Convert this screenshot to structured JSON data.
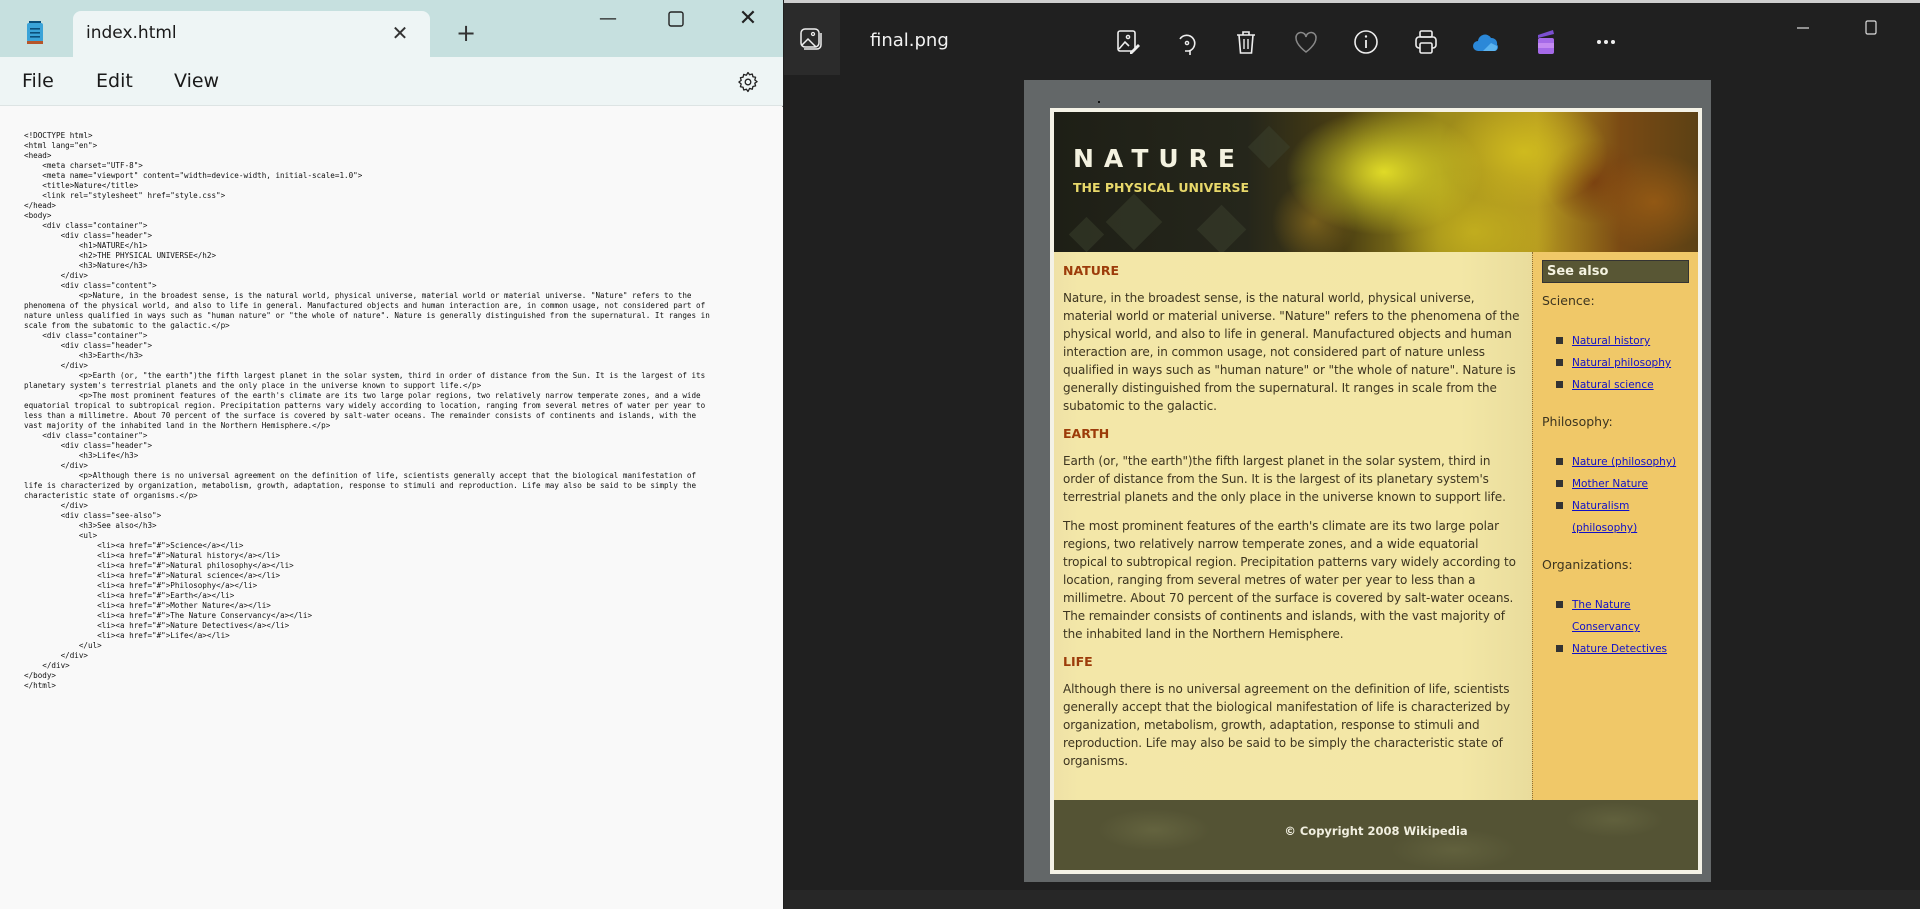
{
  "notepad": {
    "tab_title": "index.html",
    "menu": {
      "file": "File",
      "edit": "Edit",
      "view": "View"
    },
    "code_lines": [
      "<!DOCTYPE html>",
      "<html lang=\"en\">",
      "<head>",
      "    <meta charset=\"UTF-8\">",
      "    <meta name=\"viewport\" content=\"width=device-width, initial-scale=1.0\">",
      "    <title>Nature</title>",
      "    <link rel=\"stylesheet\" href=\"style.css\">",
      "</head>",
      "<body>",
      "    <div class=\"container\">",
      "        <div class=\"header\">",
      "            <h1>NATURE</h1>",
      "            <h2>THE PHYSICAL UNIVERSE</h2>",
      "            <h3>Nature</h3>",
      "        </div>",
      "        <div class=\"content\">",
      "            <p>Nature, in the broadest sense, is the natural world, physical universe, material world or material universe. \"Nature\" refers to the",
      "phenomena of the physical world, and also to life in general. Manufactured objects and human interaction are, in common usage, not considered part of",
      "nature unless qualified in ways such as \"human nature\" or \"the whole of nature\". Nature is generally distinguished from the supernatural. It ranges in",
      "scale from the subatomic to the galactic.</p>",
      "    <div class=\"container\">",
      "        <div class=\"header\">",
      "            <h3>Earth</h3>",
      "        </div>",
      "            <p>Earth (or, \"the earth\")the fifth largest planet in the solar system, third in order of distance from the Sun. It is the largest of its",
      "planetary system's terrestrial planets and the only place in the universe known to support life.</p>",
      "            <p>The most prominent features of the earth's climate are its two large polar regions, two relatively narrow temperate zones, and a wide",
      "equatorial tropical to subtropical region. Precipitation patterns vary widely according to location, ranging from several metres of water per year to",
      "less than a millimetre. About 70 percent of the surface is covered by salt-water oceans. The remainder consists of continents and islands, with the",
      "vast majority of the inhabited land in the Northern Hemisphere.</p>",
      "    <div class=\"container\">",
      "        <div class=\"header\">",
      "            <h3>Life</h3>",
      "        </div>",
      "            <p>Although there is no universal agreement on the definition of life, scientists generally accept that the biological manifestation of",
      "life is characterized by organization, metabolism, growth, adaptation, response to stimuli and reproduction. Life may also be said to be simply the",
      "characteristic state of organisms.</p>",
      "        </div>",
      "        <div class=\"see-also\">",
      "            <h3>See also</h3>",
      "            <ul>",
      "                <li><a href=\"#\">Science</a></li>",
      "                <li><a href=\"#\">Natural history</a></li>",
      "                <li><a href=\"#\">Natural philosophy</a></li>",
      "                <li><a href=\"#\">Natural science</a></li>",
      "                <li><a href=\"#\">Philosophy</a></li>",
      "                <li><a href=\"#\">Earth</a></li>",
      "                <li><a href=\"#\">Mother Nature</a></li>",
      "                <li><a href=\"#\">The Nature Conservancy</a></li>",
      "                <li><a href=\"#\">Nature Detectives</a></li>",
      "                <li><a href=\"#\">Life</a></li>",
      "            </ul>",
      "        </div>",
      "    </div>",
      "</body>",
      "</html>"
    ]
  },
  "viewer": {
    "filename": "final.png",
    "toolbar": [
      {
        "name": "edit-image-icon"
      },
      {
        "name": "rotate-icon"
      },
      {
        "name": "delete-icon"
      },
      {
        "name": "favorite-icon"
      },
      {
        "name": "info-icon"
      },
      {
        "name": "print-icon"
      },
      {
        "name": "onedrive-icon"
      },
      {
        "name": "clipchamp-icon"
      },
      {
        "name": "more-icon"
      }
    ],
    "colors": {
      "onedrive": "#2b88d8",
      "clipchamp": "#9b5de5"
    }
  },
  "site": {
    "title": "NATURE",
    "subtitle": "THE PHYSICAL UNIVERSE",
    "sections": [
      {
        "heading": "NATURE",
        "paragraphs": [
          "Nature, in the broadest sense, is the natural world, physical universe, material world or material universe. \"Nature\" refers to the phenomena of the physical world, and also to life in general. Manufactured objects and human interaction are, in common usage, not considered part of nature unless qualified in ways such as \"human nature\" or \"the whole of nature\". Nature is generally distinguished from the supernatural. It ranges in scale from the subatomic to the galactic."
        ]
      },
      {
        "heading": "EARTH",
        "paragraphs": [
          "Earth (or, \"the earth\")the fifth largest planet in the solar system, third in order of distance from the Sun. It is the largest of its planetary system's terrestrial planets and the only place in the universe known to support life.",
          "The most prominent features of the earth's climate are its two large polar regions, two relatively narrow temperate zones, and a wide equatorial tropical to subtropical region. Precipitation patterns vary widely according to location, ranging from several metres of water per year to less than a millimetre. About 70 percent of the surface is covered by salt-water oceans. The remainder consists of continents and islands, with the vast majority of the inhabited land in the Northern Hemisphere."
        ]
      },
      {
        "heading": "LIFE",
        "paragraphs": [
          "Although there is no universal agreement on the definition of life, scientists generally accept that the biological manifestation of life is characterized by organization, metabolism, growth, adaptation, response to stimuli and reproduction. Life may also be said to be simply the characteristic state of organisms."
        ]
      }
    ],
    "see_also": {
      "heading": "See also",
      "groups": [
        {
          "label": "Science:",
          "links": [
            "Natural history",
            "Natural philosophy",
            "Natural science"
          ]
        },
        {
          "label": "Philosophy:",
          "links": [
            "Nature (philosophy)",
            "Mother Nature",
            "Naturalism (philosophy)"
          ]
        },
        {
          "label": "Organizations:",
          "links": [
            "The Nature Conservancy",
            "Nature Detectives"
          ]
        }
      ]
    },
    "footer": "© Copyright 2008 Wikipedia",
    "colors": {
      "heading": "#9c3c0a",
      "content_bg": "#f3e7a8",
      "sidebar_bg": "#f0c868",
      "see_also_bg": "#585634",
      "footer_bg": "#545334",
      "link": "#1010c8"
    }
  }
}
